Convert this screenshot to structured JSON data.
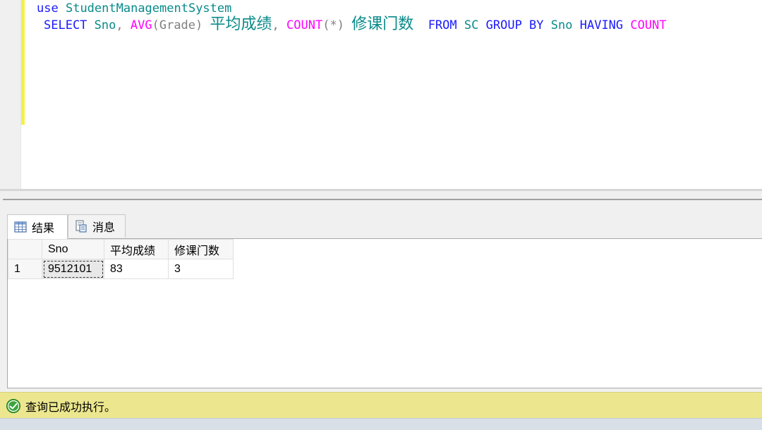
{
  "editor": {
    "line1": {
      "kw": "use",
      "db": "StudentManagementSystem"
    },
    "line2": {
      "select": "SELECT",
      "col_sno": "Sno",
      "comma1": ",",
      "avg_fn": "AVG",
      "avg_arg": "(Grade)",
      "avg_alias": "平均成绩",
      "comma2": ",",
      "count_fn": "COUNT",
      "count_arg": "(*)",
      "count_alias": "修课门数",
      "from": "FROM",
      "table": "SC",
      "group_by": "GROUP BY",
      "group_col": "Sno",
      "having": "HAVING",
      "having_fn": "COUNT"
    }
  },
  "tabs": [
    {
      "label": "结果",
      "icon": "results-grid-icon",
      "active": true
    },
    {
      "label": "消息",
      "icon": "messages-icon",
      "active": false
    }
  ],
  "results": {
    "columns": [
      "Sno",
      "平均成绩",
      "修课门数"
    ],
    "rows": [
      {
        "row_num": "1",
        "cells": [
          "9512101",
          "83",
          "3"
        ]
      }
    ]
  },
  "status": {
    "message": "查询已成功执行。",
    "icon": "success-check-icon",
    "bar_color": "#ece78e"
  },
  "colors": {
    "keyword": "#1a1aff",
    "identifier": "#0a8a8a",
    "function": "#ff00ff",
    "operator": "#808080",
    "change_bar": "#f5f04a"
  }
}
